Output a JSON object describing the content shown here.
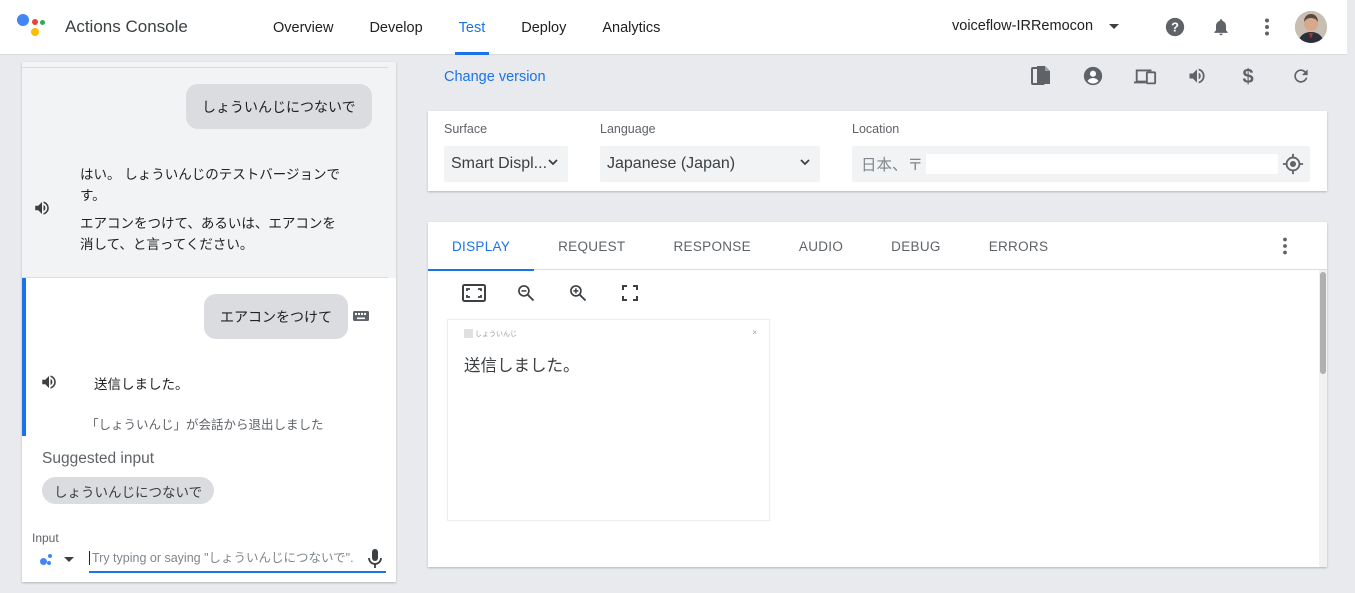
{
  "app": {
    "title": "Actions Console"
  },
  "nav": {
    "items": [
      {
        "label": "Overview"
      },
      {
        "label": "Develop"
      },
      {
        "label": "Test"
      },
      {
        "label": "Deploy"
      },
      {
        "label": "Analytics"
      }
    ],
    "active": "Test"
  },
  "project": {
    "name": "voiceflow-IRRemocon"
  },
  "header_icons": [
    "help-icon",
    "bell-icon",
    "more-vert-icon"
  ],
  "simulator": {
    "conversation": {
      "user_1": "しょういんじにつないで",
      "response_1_line1": "はい。 しょういんじのテストバージョンで",
      "response_1_line2": "す。",
      "response_1_line3": "エアコンをつけて、あるいは、エアコンを",
      "response_1_line4": "消して、と言ってください。",
      "user_2": "エアコンをつけて",
      "response_2": "送信しました。",
      "exit_note": "「しょういんじ」が会話から退出しました"
    },
    "suggested": {
      "title": "Suggested input",
      "chip": "しょういんじにつないで"
    },
    "input": {
      "label": "Input",
      "placeholder": "Try typing or saying \"しょういんじにつないで\"."
    }
  },
  "toolbar": {
    "change_version": "Change version",
    "icons": [
      "file-copy-icon",
      "account-circle-icon",
      "devices-icon",
      "volume-icon",
      "dollar-icon",
      "refresh-icon"
    ]
  },
  "settings": {
    "surface_label": "Surface",
    "surface_value": "Smart Displ...",
    "language_label": "Language",
    "language_value": "Japanese (Japan)",
    "location_label": "Location",
    "location_value": "日本、〒"
  },
  "output": {
    "tabs": [
      "DISPLAY",
      "REQUEST",
      "RESPONSE",
      "AUDIO",
      "DEBUG",
      "ERRORS"
    ],
    "active_tab": "DISPLAY",
    "display_tools": [
      "fit-screen-icon",
      "zoom-out-icon",
      "zoom-in-icon",
      "fullscreen-icon"
    ],
    "device": {
      "title": "しょういんじ",
      "close": "×",
      "text": "送信しました。"
    }
  },
  "colors": {
    "accent": "#1a73e8",
    "bubble": "#dadce0",
    "background": "#e8eaed"
  }
}
